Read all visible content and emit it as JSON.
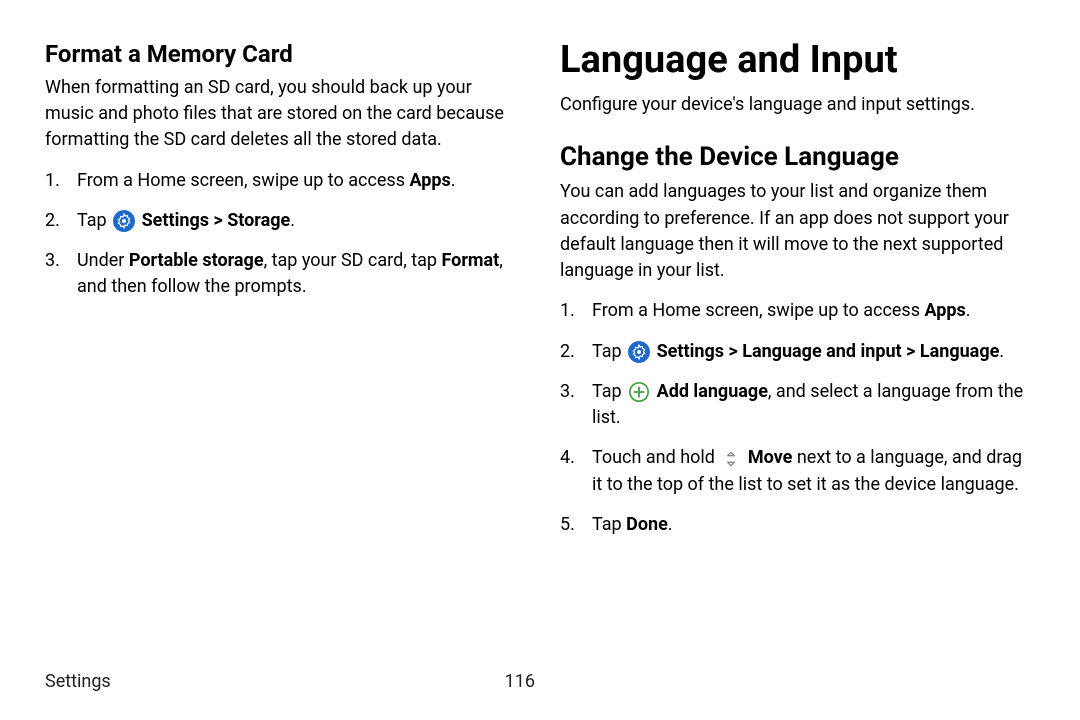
{
  "left": {
    "heading": "Format a Memory Card",
    "intro": "When formatting an SD card, you should back up your music and photo files that are stored on the card because formatting the SD card deletes all the stored data.",
    "steps": {
      "s1": {
        "pre": "From a Home screen, swipe up to access ",
        "bold1": "Apps",
        "post": "."
      },
      "s2": {
        "pre": "Tap ",
        "bold1": " Settings > Storage",
        "post": "."
      },
      "s3": {
        "pre": "Under ",
        "bold1": "Portable storage",
        "mid1": ", tap your SD card, tap ",
        "bold2": "Format",
        "post": ", and then follow the prompts."
      }
    }
  },
  "right": {
    "title": "Language and Input",
    "subtitle": "Configure your device's language and input settings.",
    "heading": "Change the Device Language",
    "intro": "You can add languages to your list and organize them according to preference. If an app does not support your default language then it will move to the next supported language in your list.",
    "steps": {
      "s1": {
        "pre": "From a Home screen, swipe up to access ",
        "bold1": "Apps",
        "post": "."
      },
      "s2": {
        "pre": "Tap ",
        "bold1": " Settings > Language and input > Language",
        "post": "."
      },
      "s3": {
        "pre": "Tap ",
        "bold1": " Add language",
        "post": ", and select a language from the list."
      },
      "s4": {
        "pre": "Touch and hold ",
        "bold1": " Move",
        "post": " next to a language, and drag it to the top of the list to set it as the device language."
      },
      "s5": {
        "pre": "Tap ",
        "bold1": "Done",
        "post": "."
      }
    }
  },
  "footer": {
    "section": "Settings",
    "page": "116"
  }
}
